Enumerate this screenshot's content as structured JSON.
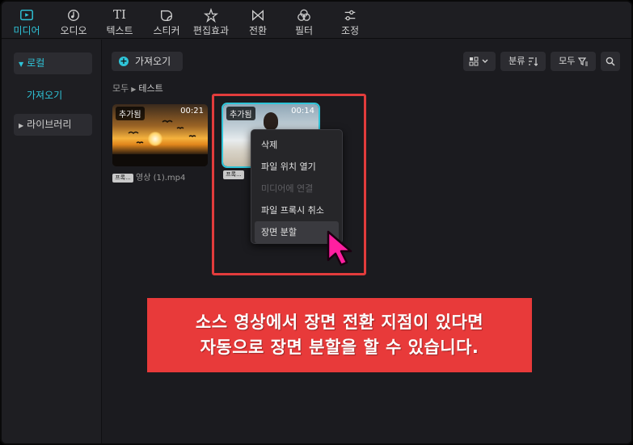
{
  "tabs": [
    {
      "label": "미디어",
      "icon": "media-icon",
      "active": true
    },
    {
      "label": "오디오",
      "icon": "audio-icon"
    },
    {
      "label": "텍스트",
      "icon": "text-icon",
      "glyph": "TI"
    },
    {
      "label": "스티커",
      "icon": "sticker-icon"
    },
    {
      "label": "편집효과",
      "icon": "effects-icon"
    },
    {
      "label": "전환",
      "icon": "transition-icon"
    },
    {
      "label": "필터",
      "icon": "filter-icon"
    },
    {
      "label": "조정",
      "icon": "adjust-icon"
    }
  ],
  "sidebar": {
    "local": "로컬",
    "import": "가져오기",
    "library": "라이브러리"
  },
  "toolbar": {
    "import_label": "가져오기",
    "sort_label": "분류",
    "filter_label": "모두"
  },
  "breadcrumb": {
    "root": "모두",
    "current": "테스트"
  },
  "media": [
    {
      "badge": "추가됨",
      "duration": "00:21",
      "chip": "프록...",
      "filename": "영상 (1).mp4"
    },
    {
      "badge": "추가됨",
      "duration": "00:14",
      "chip": "프록..."
    }
  ],
  "context_menu": [
    {
      "label": "삭제"
    },
    {
      "label": "파일 위치 열기"
    },
    {
      "label": "미디어에 연결",
      "disabled": true
    },
    {
      "label": "파일 프록시 취소"
    },
    {
      "label": "장면 분할",
      "hovered": true
    }
  ],
  "caption": {
    "line1": "소스 영상에서 장면 전환 지점이 있다면",
    "line2": "자동으로 장면 분할을 할 수 있습니다."
  },
  "colors": {
    "accent": "#2fc4d8",
    "highlight": "#e23c3c",
    "caption_bg": "#e83a3a",
    "cursor": "#ff1fa0"
  }
}
